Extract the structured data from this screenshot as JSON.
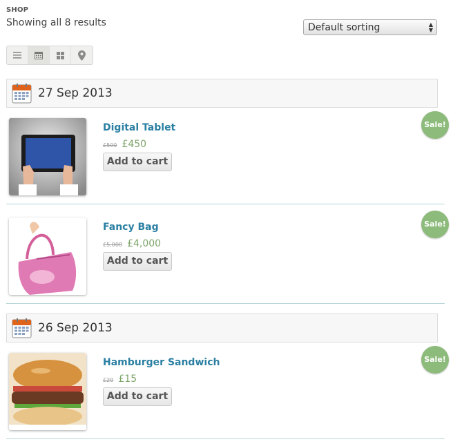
{
  "header": {
    "shop_label": "SHOP",
    "results_text": "Showing all 8 results",
    "sort_selected": "Default sorting"
  },
  "view_modes": [
    {
      "icon": "list-icon"
    },
    {
      "icon": "calendar-view-icon",
      "active": true
    },
    {
      "icon": "grid-icon"
    },
    {
      "icon": "map-pin-icon"
    }
  ],
  "groups": [
    {
      "date": "27 Sep 2013",
      "products": [
        {
          "title": "Digital Tablet",
          "old_price": "£500",
          "price": "£450",
          "button": "Add to cart",
          "badge": "Sale!"
        },
        {
          "title": "Fancy Bag",
          "old_price": "£5,000",
          "price": "£4,000",
          "button": "Add to cart",
          "badge": "Sale!"
        }
      ]
    },
    {
      "date": "26 Sep 2013",
      "products": [
        {
          "title": "Hamburger Sandwich",
          "old_price": "£20",
          "price": "£15",
          "button": "Add to cart",
          "badge": "Sale!"
        }
      ]
    }
  ],
  "colors": {
    "link": "#2a7fa2",
    "price": "#7fa56b",
    "sale_badge": "#8dbb7b",
    "divider": "#b8d6d8"
  }
}
